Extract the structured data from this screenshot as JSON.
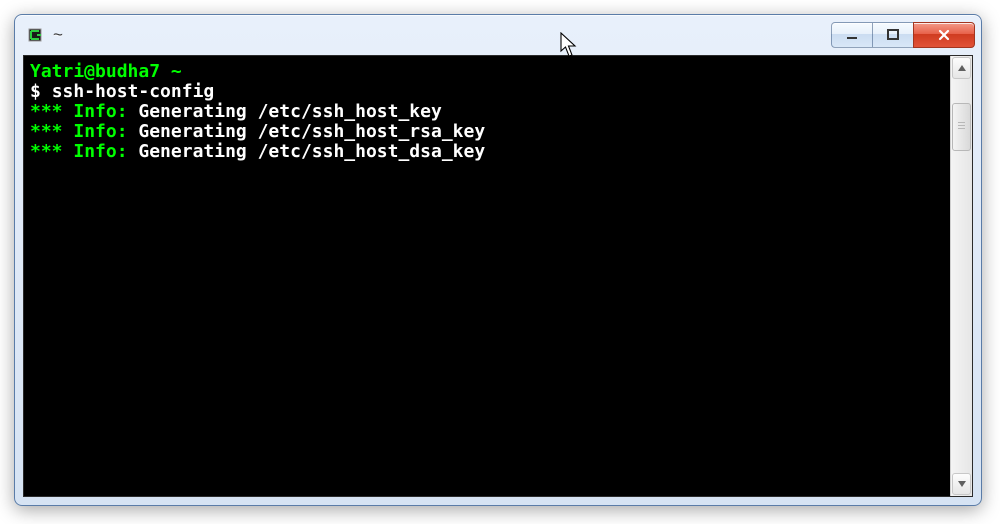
{
  "window": {
    "title": "~"
  },
  "terminal": {
    "prompt": "Yatri@budha7 ~",
    "command_prefix": "$ ",
    "command": "ssh-host-config",
    "lines": [
      {
        "stars": "***",
        "label": " Info:",
        "text": " Generating /etc/ssh_host_key"
      },
      {
        "stars": "***",
        "label": " Info:",
        "text": " Generating /etc/ssh_host_rsa_key"
      },
      {
        "stars": "***",
        "label": " Info:",
        "text": " Generating /etc/ssh_host_dsa_key"
      }
    ]
  }
}
